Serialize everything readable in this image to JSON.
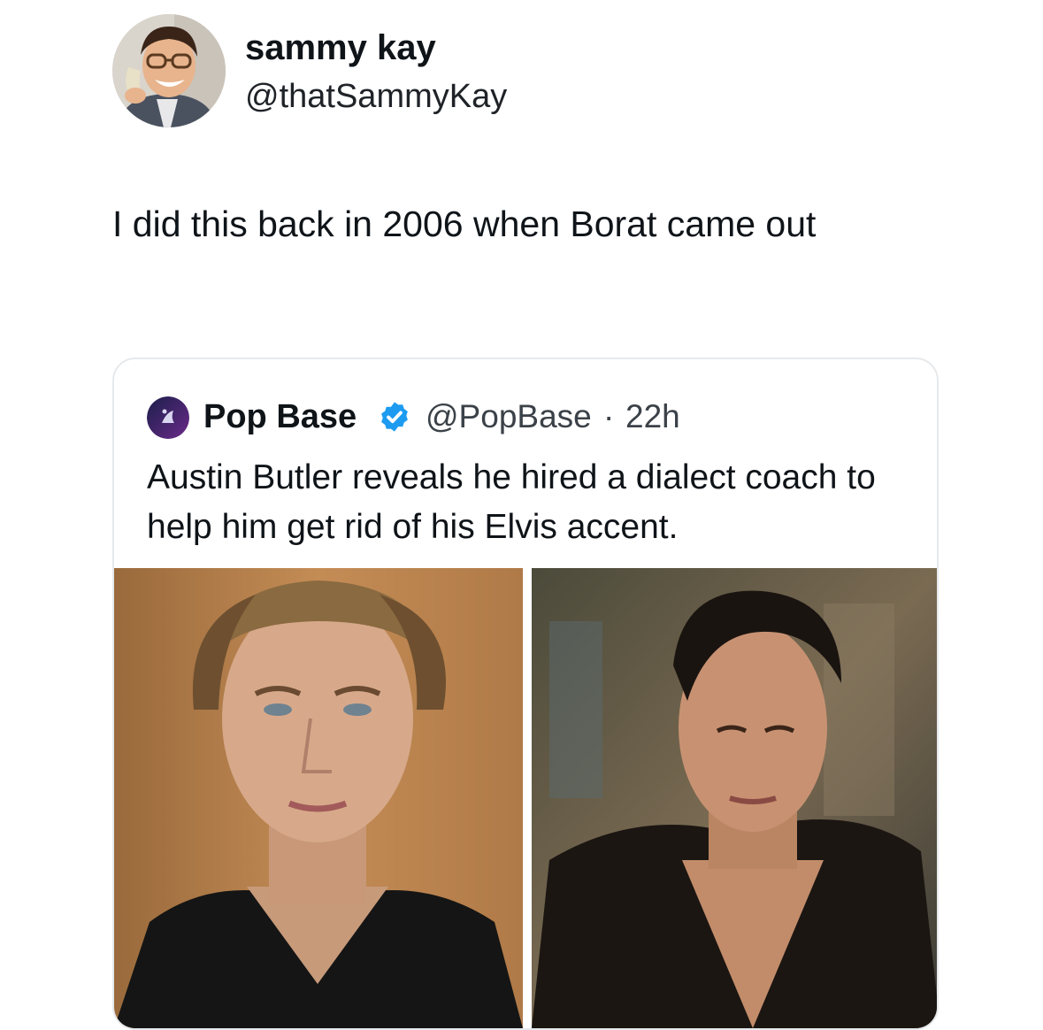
{
  "author": {
    "display_name": "sammy kay",
    "handle": "@thatSammyKay",
    "avatar_icon": "profile-photo"
  },
  "tweet": {
    "text": "I did this back in 2006 when Borat came out"
  },
  "quoted_tweet": {
    "display_name": "Pop Base",
    "verified_icon": "verified-badge-icon",
    "handle": "@PopBase",
    "separator": "·",
    "time": "22h",
    "text": "Austin Butler reveals he hired a dialect coach to help him get rid of his Elvis accent.",
    "media": [
      {
        "name": "left-photo"
      },
      {
        "name": "right-photo"
      }
    ]
  },
  "colors": {
    "text": "#0f1419",
    "secondary": "#3b4148",
    "border": "#e6e9ec",
    "verified": "#1d9bf0"
  }
}
